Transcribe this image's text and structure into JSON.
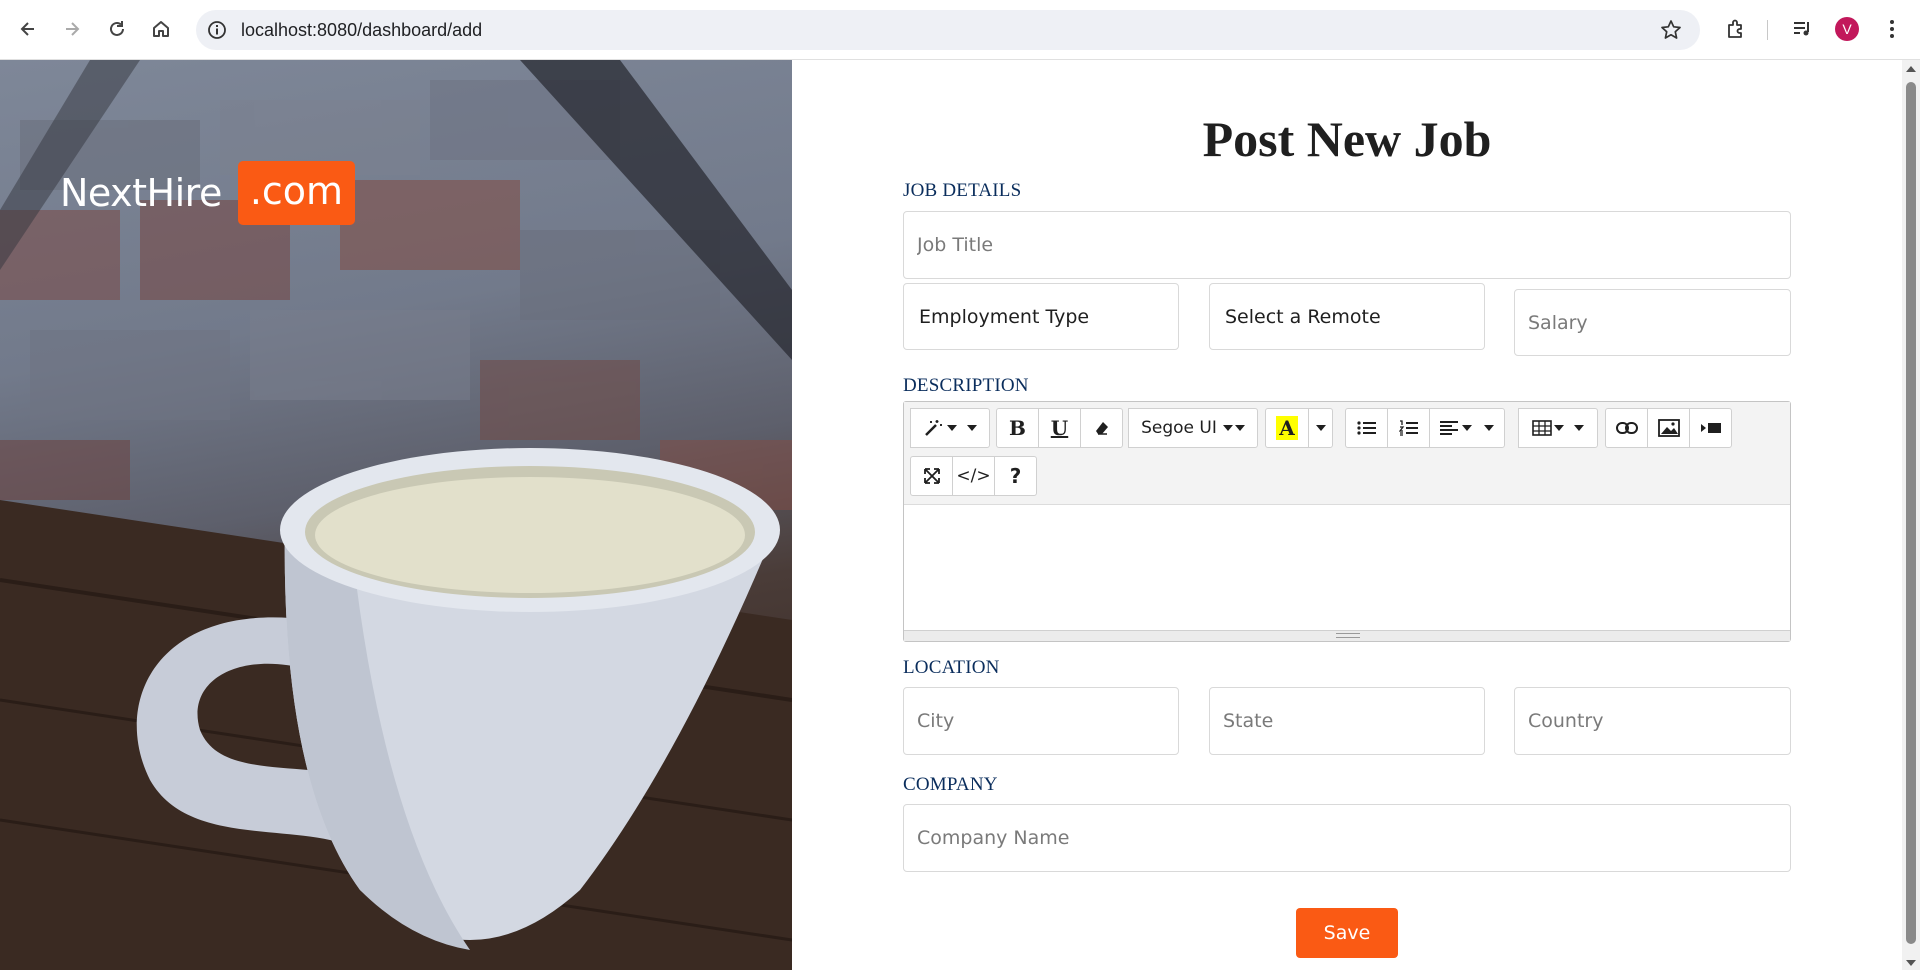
{
  "browser": {
    "url": "localhost:8080/dashboard/add",
    "profile_initial": "V",
    "icons": [
      "back-icon",
      "forward-icon",
      "reload-icon",
      "home-icon",
      "site-info-icon",
      "bookmark-star-icon",
      "extensions-icon",
      "media-control-icon",
      "more-menu-icon"
    ]
  },
  "brand": {
    "name": "NextHire",
    "badge": ".com",
    "accent_color": "#fa5a14"
  },
  "form": {
    "title": "Post New Job",
    "sections": {
      "job_details": "JOB DETAILS",
      "description": "DESCRIPTION",
      "location": "LOCATION",
      "company": "COMPANY"
    },
    "job_title_placeholder": "Job Title",
    "employment_type": "Employment Type",
    "remote": "Select a Remote",
    "salary_placeholder": "Salary",
    "city_placeholder": "City",
    "state_placeholder": "State",
    "country_placeholder": "Country",
    "company_placeholder": "Company Name",
    "save_label": "Save"
  },
  "editor": {
    "font_name": "Segoe UI",
    "toolbar_icons": [
      "magic-style-icon",
      "bold-icon",
      "underline-icon",
      "eraser-icon",
      "font-name-dropdown",
      "highlight-color-icon",
      "unordered-list-icon",
      "ordered-list-icon",
      "align-icon",
      "table-icon",
      "link-icon",
      "picture-icon",
      "video-icon",
      "fullscreen-icon",
      "code-view-icon",
      "help-icon"
    ]
  }
}
